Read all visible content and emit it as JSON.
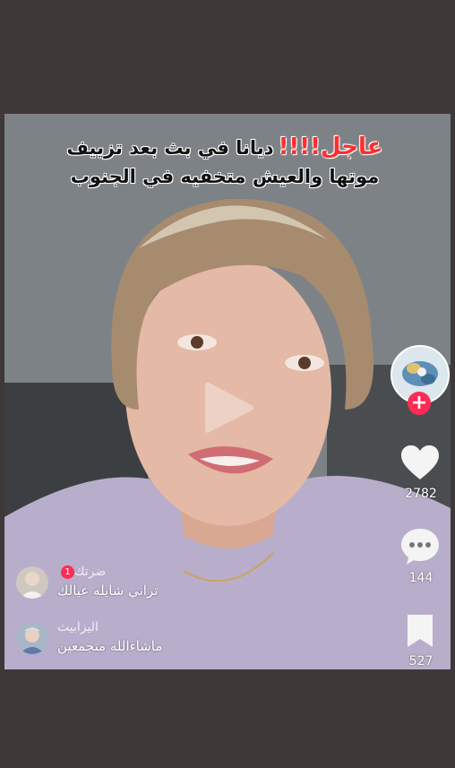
{
  "caption": {
    "urgent": "عاجل!!!!",
    "headline": "ديانا في بث بعد تزييف موتها والعيش متخفيه في الجنوب"
  },
  "actions": {
    "likes": "2782",
    "comments": "144",
    "saves": "527"
  },
  "live_comments": [
    {
      "name": "ضرتك",
      "badge": "1",
      "text": "تراني شايله عيالك"
    },
    {
      "name": "اليزابيث",
      "text": "ماشاءالله متجمعين"
    }
  ],
  "colors": {
    "background": "#3f3838",
    "accent": "#fe2c55",
    "urgent": "#ff2d2d"
  },
  "icons": [
    "play-icon",
    "plus-icon",
    "heart-icon",
    "comment-icon",
    "bookmark-icon"
  ]
}
